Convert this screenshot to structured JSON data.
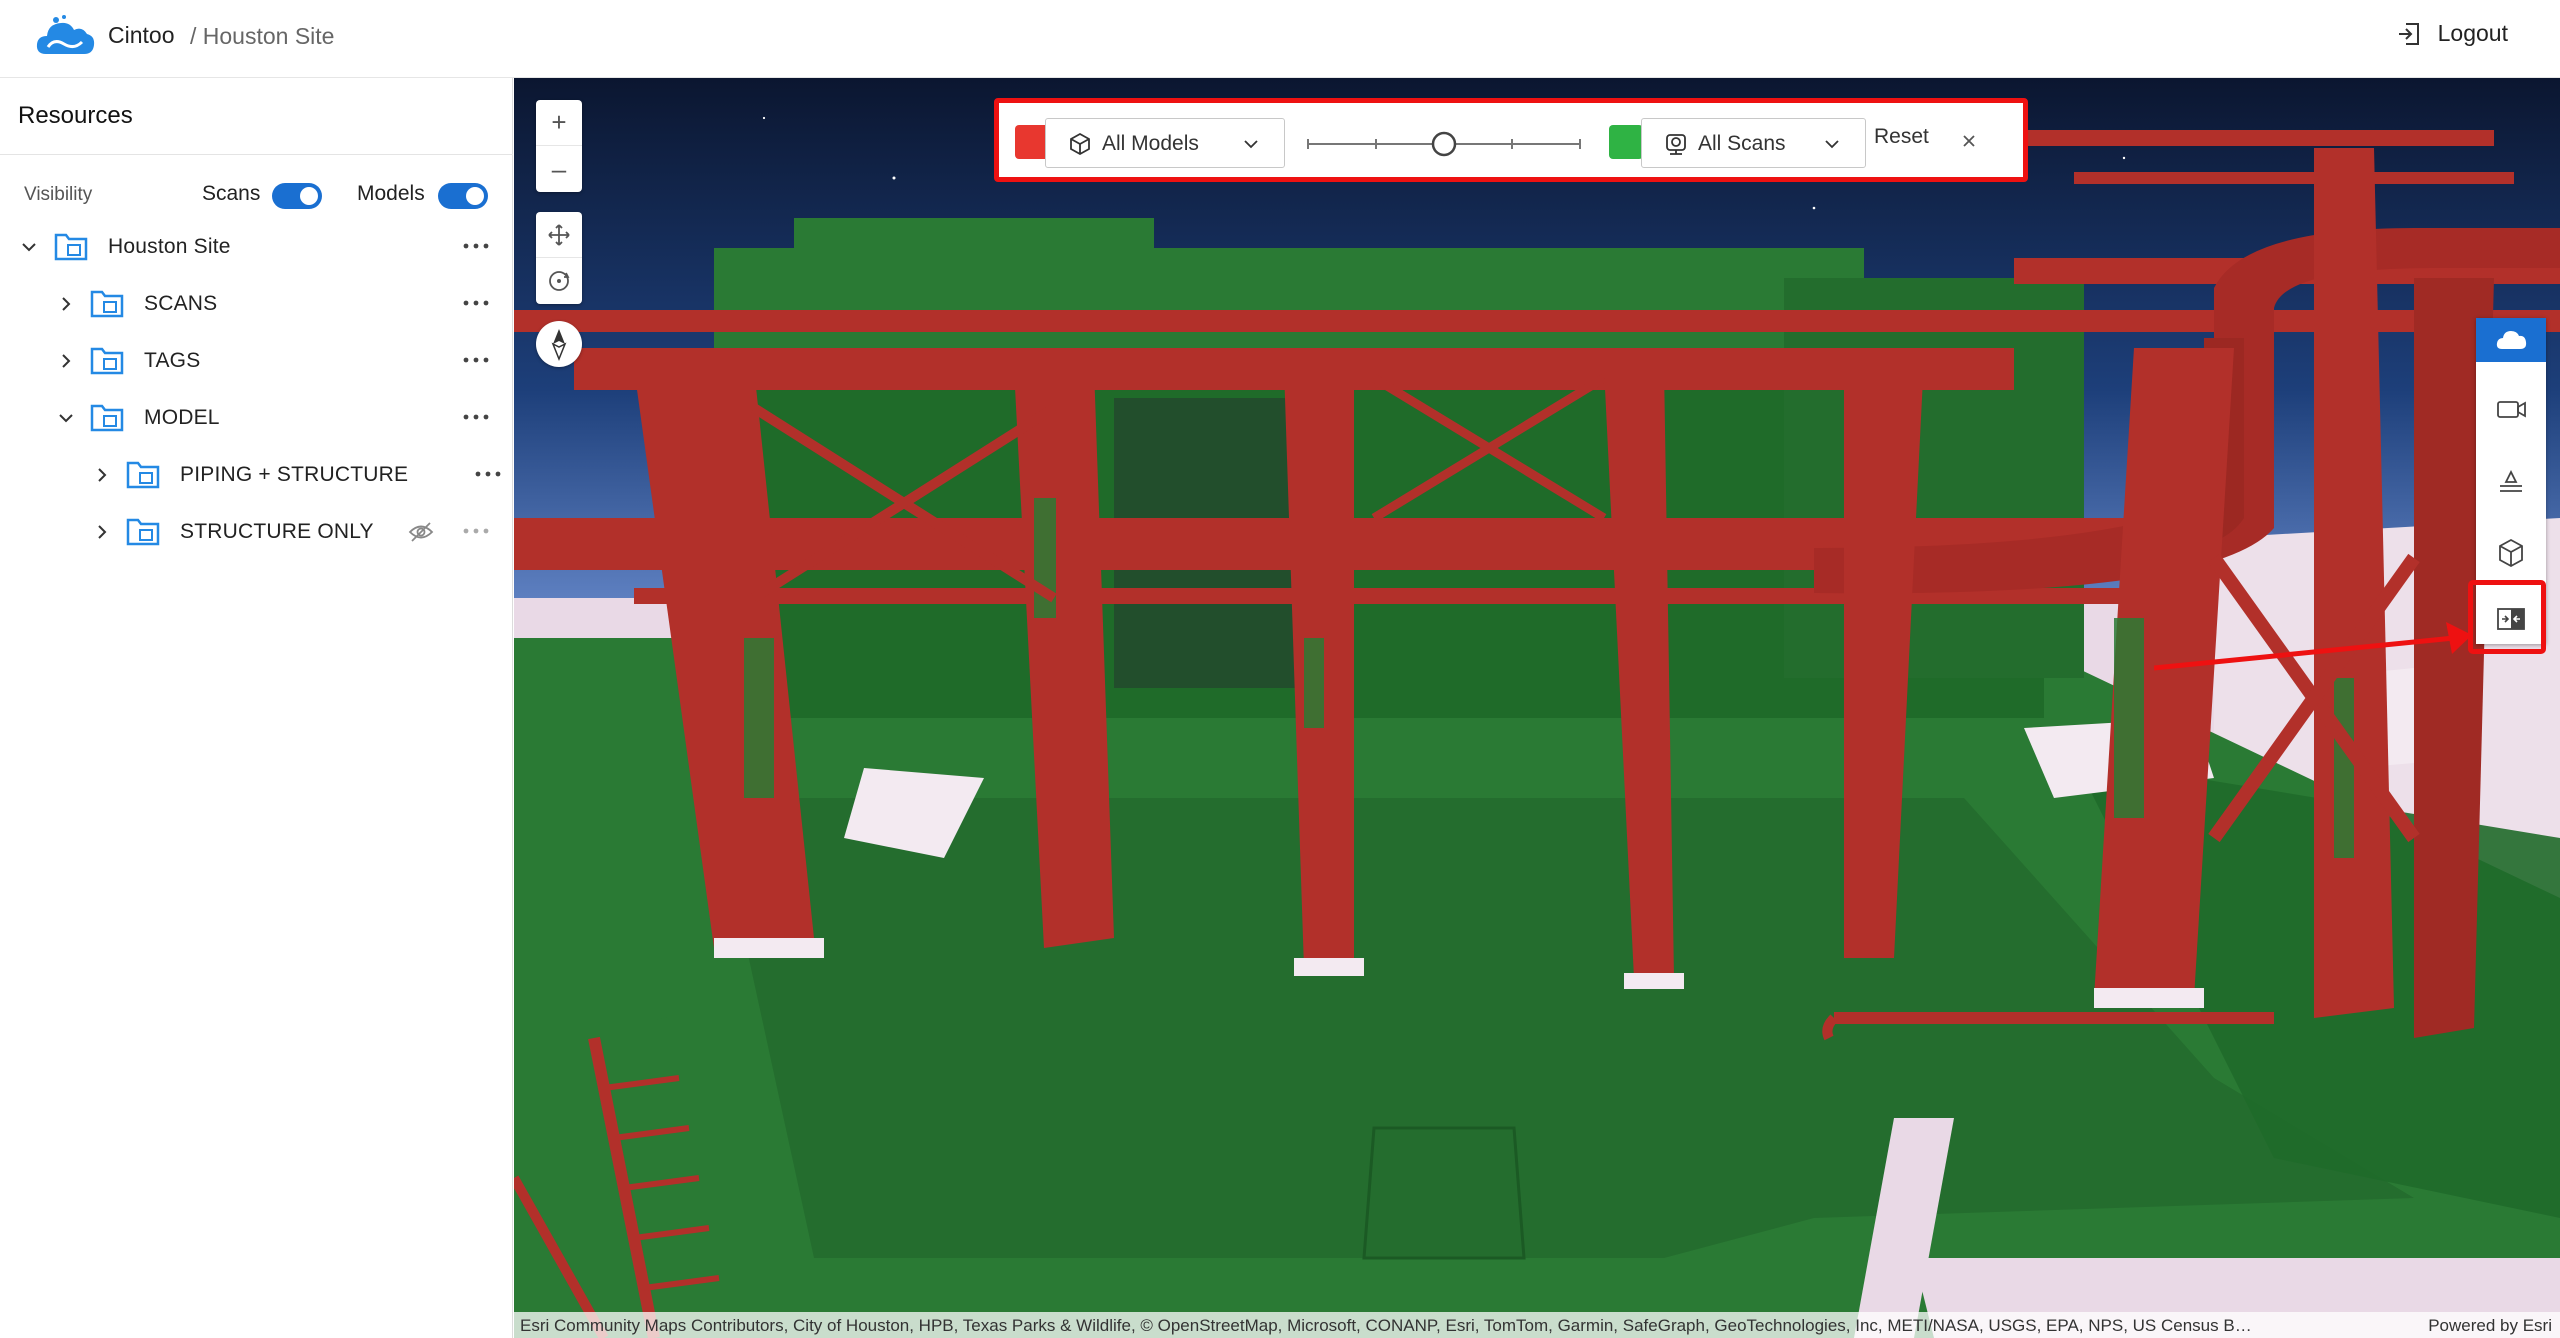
{
  "header": {
    "app_name": "Cintoo",
    "breadcrumb": "/ Houston Site",
    "logout_label": "Logout"
  },
  "sidebar": {
    "title": "Resources",
    "visibility_label": "Visibility",
    "scans_toggle_label": "Scans",
    "models_toggle_label": "Models",
    "scans_on": true,
    "models_on": true,
    "tree": [
      {
        "label": "Houston Site",
        "expanded": true,
        "level": 0
      },
      {
        "label": "SCANS",
        "expanded": false,
        "level": 1
      },
      {
        "label": "TAGS",
        "expanded": false,
        "level": 1
      },
      {
        "label": "MODEL",
        "expanded": true,
        "level": 1
      },
      {
        "label": "PIPING + STRUCTURE",
        "expanded": false,
        "level": 2
      },
      {
        "label": "STRUCTURE ONLY",
        "expanded": false,
        "level": 2,
        "hidden": true
      }
    ]
  },
  "viewer": {
    "zoom_in": "+",
    "zoom_out": "–",
    "attribution": "Esri Community Maps Contributors, City of Houston, HPB, Texas Parks & Wildlife, © OpenStreetMap, Microsoft, CONANP, Esri, TomTom, Garmin, SafeGraph, GeoTechnologies, Inc, METI/NASA, USGS, EPA, NPS, US Census Bureau, U...",
    "powered_by": "Powered by Esri"
  },
  "compare_bar": {
    "left_color": "#e8372f",
    "right_color": "#2fb344",
    "models_dropdown": "All Models",
    "scans_dropdown": "All Scans",
    "slider_fraction": 0.5,
    "reset_label": "Reset",
    "close_icon": "close-icon"
  },
  "right_toolbar": {
    "items": [
      "cloud-icon",
      "camera-icon",
      "layers-scan-icon",
      "model-cube-icon",
      "compare-icon"
    ],
    "active_index": 0,
    "accent": "#1a6fd1"
  },
  "colors": {
    "model_red": "#b2302a",
    "scan_green": "#2a7a34",
    "sky": "#12213f",
    "ground": "#e9d9e6"
  }
}
